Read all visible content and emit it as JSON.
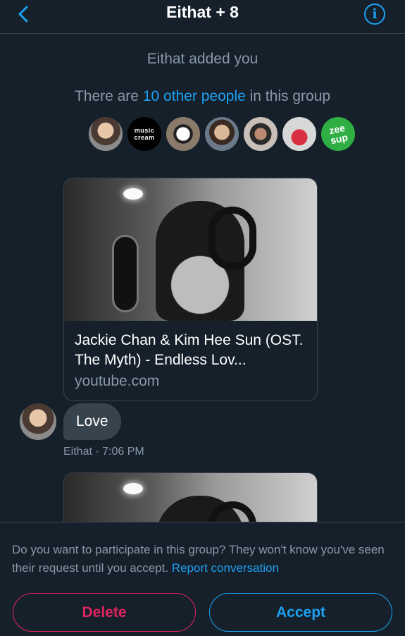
{
  "header": {
    "title": "Eithat + 8",
    "back_icon": "chevron-left-icon",
    "info_label": "i"
  },
  "group_info": {
    "added_text": "Eithat added you",
    "others_prefix": "There are ",
    "others_link": "10 other people",
    "others_suffix": " in this group",
    "music_cream_line1": "music",
    "music_cream_line2": "cream",
    "badge_line1": "zee",
    "badge_line2": "sup"
  },
  "messages": [
    {
      "card_title": "Jackie Chan & Kim Hee Sun (OST. The Myth) - Endless Lov...",
      "card_domain": "youtube.com"
    }
  ],
  "bubble": {
    "text": "Love",
    "sender": "Eithat",
    "time": "7:06 PM"
  },
  "footer": {
    "prompt": "Do you want to participate in this group? They won't know you've seen their request until you accept. ",
    "report_link": "Report conversation",
    "delete_label": "Delete",
    "accept_label": "Accept"
  },
  "colors": {
    "background": "#15202b",
    "accent": "#1da1f2",
    "danger": "#e0245e",
    "secondary_text": "#8899a6"
  }
}
